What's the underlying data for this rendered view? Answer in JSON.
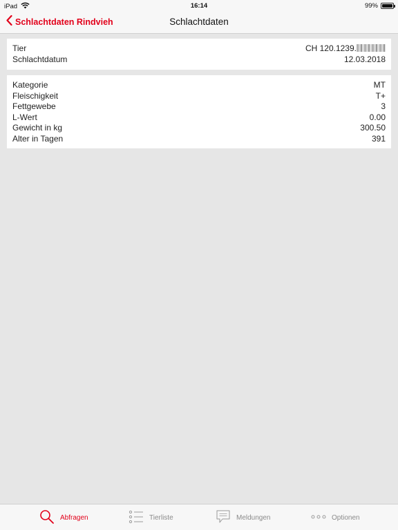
{
  "status_bar": {
    "device": "iPad",
    "time": "16:14",
    "battery_text": "99%",
    "battery_level": 0.99,
    "wifi_icon": "wifi-icon"
  },
  "nav": {
    "back_label": "Schlachtdaten Rindvieh",
    "title": "Schlachtdaten",
    "accent_color": "#e2001a"
  },
  "identity_card": {
    "rows": [
      {
        "label": "Tier",
        "value": "CH 120.1239."
      },
      {
        "label": "Schlachtdatum",
        "value": "12.03.2018"
      }
    ]
  },
  "metrics_card": {
    "rows": [
      {
        "label": "Kategorie",
        "value": "MT"
      },
      {
        "label": "Fleischigkeit",
        "value": "T+"
      },
      {
        "label": "Fettgewebe",
        "value": "3"
      },
      {
        "label": "L-Wert",
        "value": "0.00"
      },
      {
        "label": "Gewicht in kg",
        "value": "300.50"
      },
      {
        "label": "Alter in Tagen",
        "value": "391"
      }
    ]
  },
  "tab_bar": {
    "tabs": [
      {
        "label": "Abfragen",
        "icon": "search-icon",
        "active": true
      },
      {
        "label": "Tierliste",
        "icon": "list-icon",
        "active": false
      },
      {
        "label": "Meldungen",
        "icon": "speech-bubble-icon",
        "active": false
      },
      {
        "label": "Optionen",
        "icon": "more-dots-icon",
        "active": false
      }
    ]
  }
}
